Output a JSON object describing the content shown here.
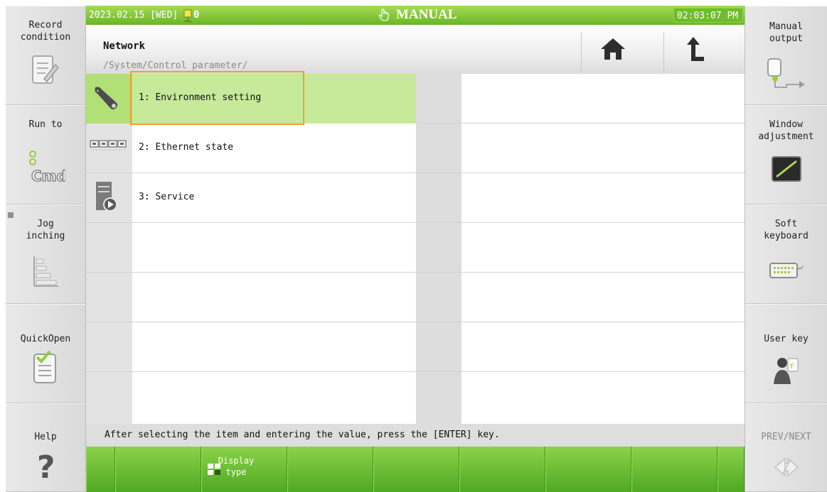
{
  "status": {
    "date": "2023.02.15 [WED]",
    "counter": "0",
    "mode": "MANUAL",
    "time": "02:03:07 PM"
  },
  "header": {
    "title": "Network",
    "path": "/System/Control parameter/"
  },
  "list": [
    {
      "label": "1: Environment setting",
      "icon": "wrench-icon",
      "selected": true
    },
    {
      "label": "2: Ethernet state",
      "icon": "ethernet-ports-icon",
      "selected": false
    },
    {
      "label": "3: Service",
      "icon": "service-server-icon",
      "selected": false
    }
  ],
  "message": "After selecting the item and entering the value, press the [ENTER] key.",
  "left_buttons": [
    {
      "line1": "Record",
      "line2": "condition"
    },
    {
      "line1": "Run to",
      "line2": ""
    },
    {
      "line1": "Jog",
      "line2": "inching"
    },
    {
      "line1": "QuickOpen",
      "line2": ""
    },
    {
      "line1": "Help",
      "line2": ""
    }
  ],
  "right_buttons": [
    {
      "line1": "Manual",
      "line2": "output"
    },
    {
      "line1": "Window",
      "line2": "adjustment"
    },
    {
      "line1": "Soft",
      "line2": "keyboard"
    },
    {
      "line1": "User key",
      "line2": ""
    },
    {
      "line1": "PREV/NEXT",
      "line2": ""
    }
  ],
  "fkeys": {
    "display_type_line1": "Display",
    "display_type_line2": "type"
  },
  "colors": {
    "status_green": "#6ab526",
    "selected_row": "#c6e99a",
    "selection_border": "#f0a030"
  }
}
